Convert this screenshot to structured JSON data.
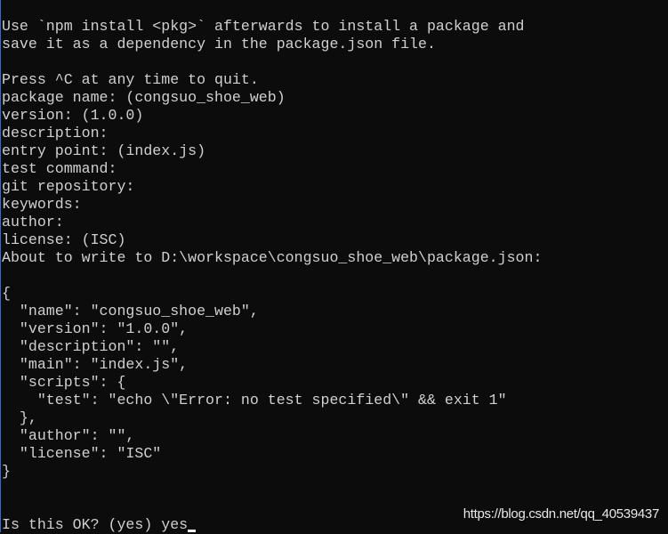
{
  "terminal": {
    "lines": [
      "Use `npm install <pkg>` afterwards to install a package and",
      "save it as a dependency in the package.json file.",
      "",
      "Press ^C at any time to quit.",
      "package name: (congsuo_shoe_web)",
      "version: (1.0.0)",
      "description:",
      "entry point: (index.js)",
      "test command:",
      "git repository:",
      "keywords:",
      "author:",
      "license: (ISC)",
      "About to write to D:\\workspace\\congsuo_shoe_web\\package.json:",
      "",
      "{",
      "  \"name\": \"congsuo_shoe_web\",",
      "  \"version\": \"1.0.0\",",
      "  \"description\": \"\",",
      "  \"main\": \"index.js\",",
      "  \"scripts\": {",
      "    \"test\": \"echo \\\"Error: no test specified\\\" && exit 1\"",
      "  },",
      "  \"author\": \"\",",
      "  \"license\": \"ISC\"",
      "}",
      "",
      ""
    ],
    "prompt": "Is this OK? (yes) yes"
  },
  "watermark": "https://blog.csdn.net/qq_40539437",
  "colors": {
    "background": "#0c0c0c",
    "text": "#d0d0d0"
  }
}
